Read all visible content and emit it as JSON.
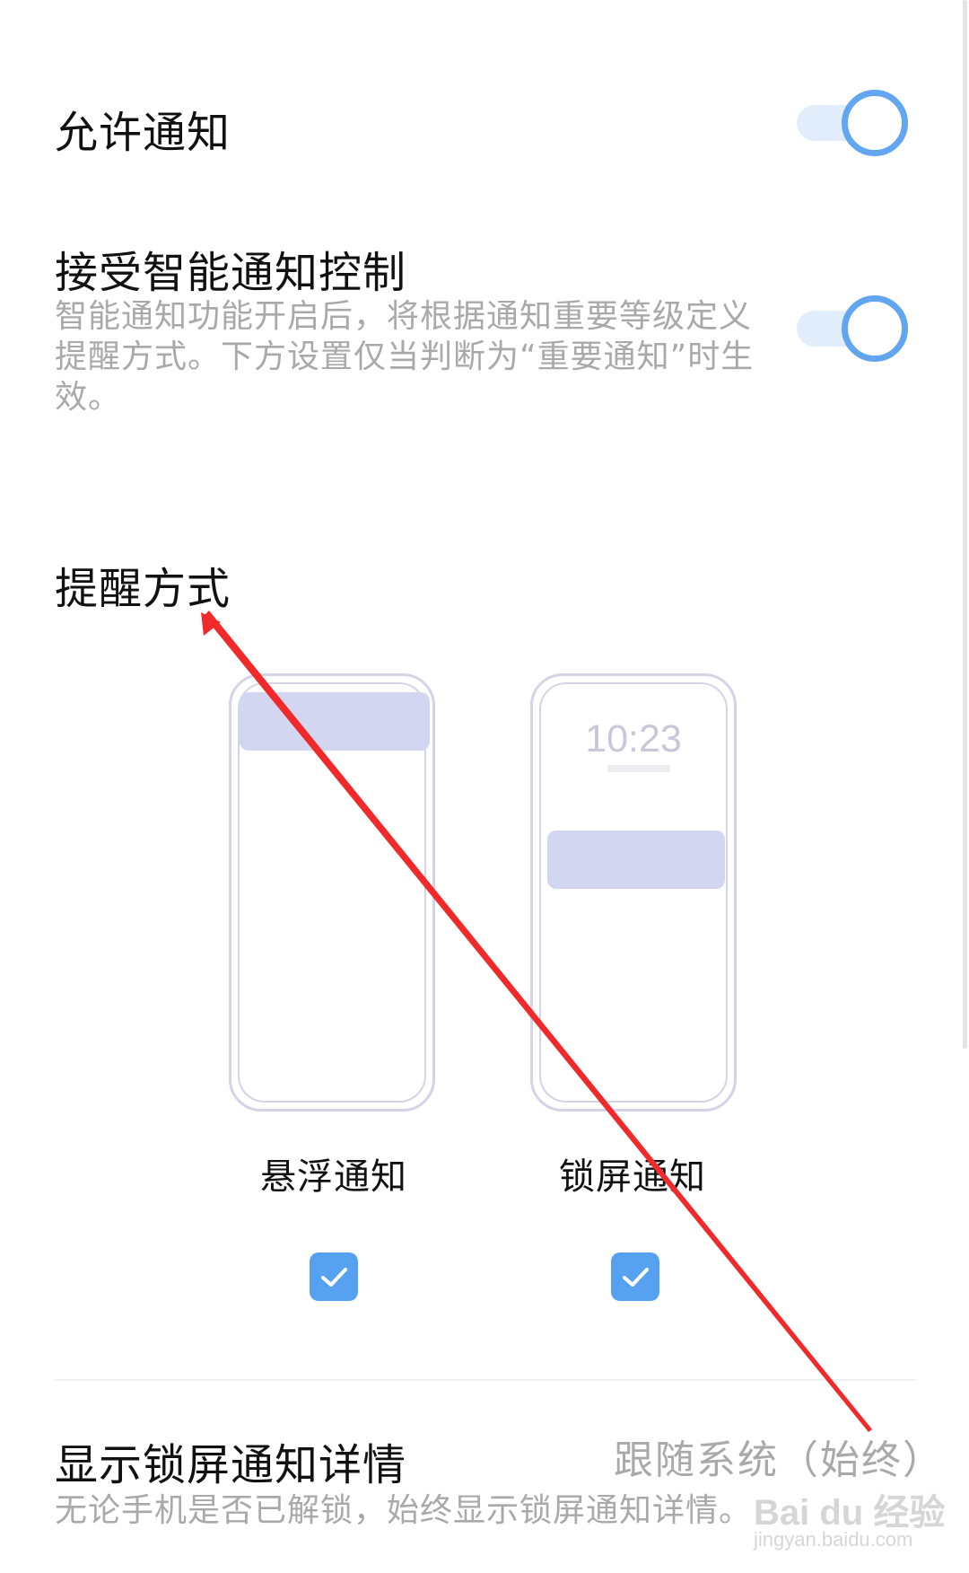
{
  "allow_notifications": {
    "title": "允许通知",
    "enabled": true
  },
  "smart_control": {
    "title": "接受智能通知控制",
    "description": "智能通知功能开启后，将根据通知重要等级定义提醒方式。下方设置仅当判断为“重要通知”时生效。",
    "enabled": true
  },
  "reminder_section": {
    "title": "提醒方式",
    "options": [
      {
        "label": "悬浮通知",
        "checked": true
      },
      {
        "label": "锁屏通知",
        "checked": true,
        "clock": "10:23"
      }
    ]
  },
  "lock_screen_details": {
    "title": "显示锁屏通知详情",
    "value": "跟随系统（始终）",
    "description": "无论手机是否已解锁，始终显示锁屏通知详情。"
  },
  "watermark": {
    "brand": "Bai du 经验",
    "url": "jingyan.baidu.com"
  },
  "colors": {
    "accent": "#56a2f0",
    "toggle_track": "#e2edfb",
    "toggle_ring": "#63a6f0",
    "annotation_arrow": "#f02a2a"
  }
}
